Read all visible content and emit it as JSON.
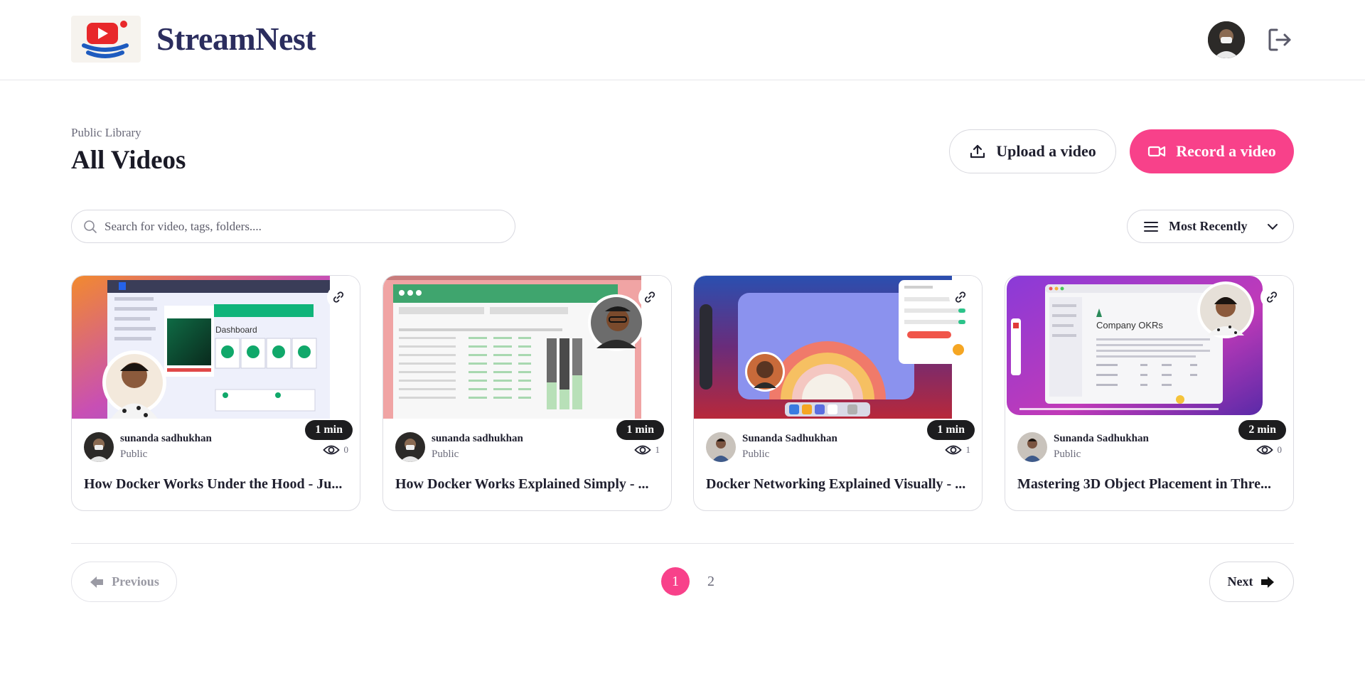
{
  "header": {
    "brand": "StreamNest",
    "logo_icon": "streamnest-logo-icon",
    "avatar_icon": "user-avatar",
    "logout_icon": "logout-icon"
  },
  "page": {
    "subtitle": "Public Library",
    "title": "All Videos",
    "upload_label": "Upload a video",
    "record_label": "Record a video"
  },
  "search": {
    "placeholder": "Search for video, tags, folders...."
  },
  "sort": {
    "selected": "Most Recently"
  },
  "colors": {
    "accent": "#f8418a",
    "brand_text": "#2b2d5e"
  },
  "videos": [
    {
      "author": "sunanda sadhukhan",
      "visibility": "Public",
      "duration": "1 min",
      "views": "0",
      "title": "How Docker Works Under the Hood - Ju..."
    },
    {
      "author": "sunanda sadhukhan",
      "visibility": "Public",
      "duration": "1 min",
      "views": "1",
      "title": "How Docker Works Explained Simply - ..."
    },
    {
      "author": "Sunanda Sadhukhan",
      "visibility": "Public",
      "duration": "1 min",
      "views": "1",
      "title": "Docker Networking Explained Visually - ..."
    },
    {
      "author": "Sunanda Sadhukhan",
      "visibility": "Public",
      "duration": "2 min",
      "views": "0",
      "title": "Mastering 3D Object Placement in Thre..."
    }
  ],
  "thumb_text": {
    "dashboard": "Dashboard",
    "okrs": "Company OKRs"
  },
  "pagination": {
    "previous": "Previous",
    "next": "Next",
    "pages": [
      "1",
      "2"
    ],
    "current": "1"
  }
}
